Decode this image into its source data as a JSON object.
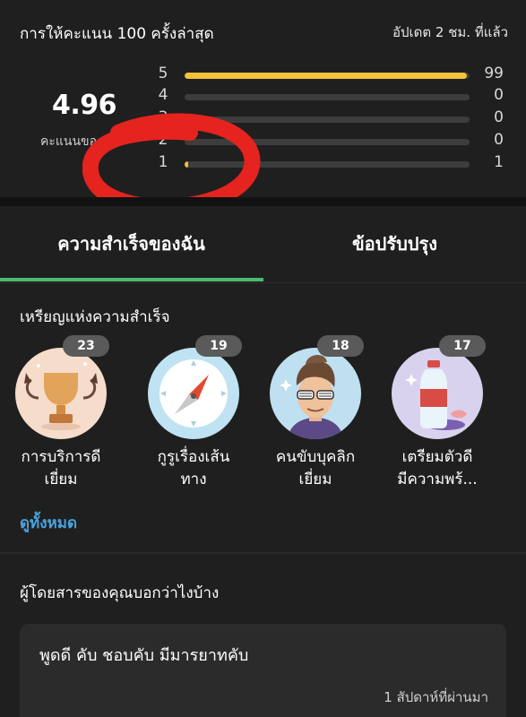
{
  "rating": {
    "title": "การให้คะแนน 100 ครั้งล่าสุด",
    "updated": "อัปเดต 2 ชม. ที่แล้ว",
    "score": "4.96",
    "score_label": "คะแนนของ",
    "bar_color": "#f3c13a",
    "bars": [
      {
        "star": "5",
        "count": "99",
        "fraction": 0.99
      },
      {
        "star": "4",
        "count": "0",
        "fraction": 0
      },
      {
        "star": "3",
        "count": "0",
        "fraction": 0
      },
      {
        "star": "2",
        "count": "0",
        "fraction": 0
      },
      {
        "star": "1",
        "count": "1",
        "fraction": 0.01
      }
    ]
  },
  "tabs": {
    "active": "ความสำเร็จของฉัน",
    "other": "ข้อปรับปรุง",
    "active_color": "#4bb96f"
  },
  "achievements": {
    "title": "เหรียญแห่งความสำเร็จ",
    "see_all": "ดูทั้งหมด",
    "badges": [
      {
        "count": "23",
        "line1": "การบริการดี",
        "line2": "เยี่ยม",
        "icon": "trophy-icon"
      },
      {
        "count": "19",
        "line1": "กูรูเรื่องเส้น",
        "line2": "ทาง",
        "icon": "compass-icon"
      },
      {
        "count": "18",
        "line1": "คนขับบุคลิก",
        "line2": "เยี่ยม",
        "icon": "driver-avatar-icon"
      },
      {
        "count": "17",
        "line1": "เตรียมตัวดี",
        "line2": "มีความพร้...",
        "icon": "water-bottle-icon"
      }
    ]
  },
  "feedback": {
    "title": "ผู้โดยสารของคุณบอกว่าไงบ้าง",
    "comment": "พูดดี คับ  ชอบคับ มีมารยาทคับ",
    "time": "1 สัปดาห์ที่ผ่านมา"
  }
}
